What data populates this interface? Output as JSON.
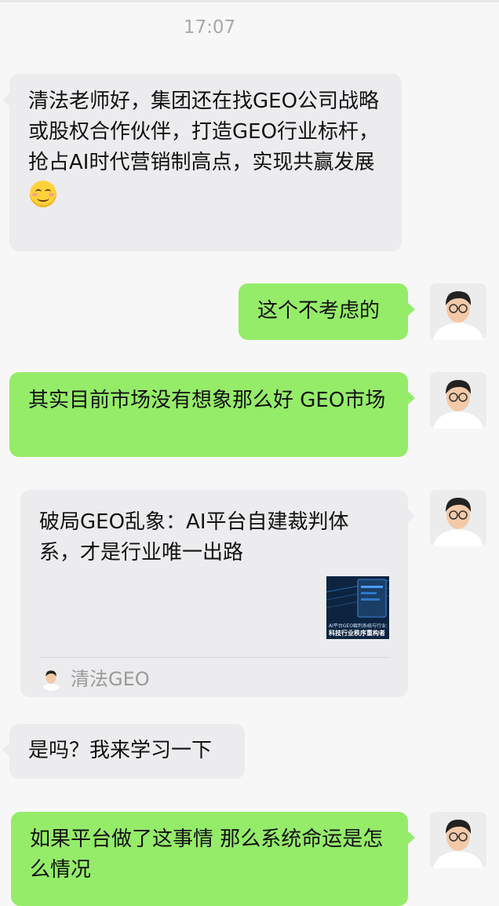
{
  "time": "17:07",
  "messages": [
    {
      "side": "left",
      "text": "清法老师好，集团还在找GEO公司战略或股权合作伙伴，打造GEO行业标杆，抢占AI时代营销制高点，实现共赢发展",
      "emoji": "smiling-face-icon"
    },
    {
      "side": "right",
      "text": "这个不考虑的"
    },
    {
      "side": "right",
      "text": "其实目前市场没有想象那么好 GEO市场"
    },
    {
      "side": "right",
      "type": "link-card",
      "title": "破局GEO乱象：AI平台自建裁判体系，才是行业唯一出路",
      "thumb_caption": "AI平台GEO裁判系统与行业治理，是",
      "thumb_headline": "科技行业秩序重构者",
      "source": "清法GEO"
    },
    {
      "side": "left",
      "text": "是吗？我来学习一下"
    },
    {
      "side": "right",
      "text": "如果平台做了这事情 那么系统命运是怎么情况"
    }
  ],
  "colors": {
    "background": "#f7f7f7",
    "incoming": "#ececee",
    "outgoing": "#95ec69",
    "time": "#a8a8a8"
  }
}
